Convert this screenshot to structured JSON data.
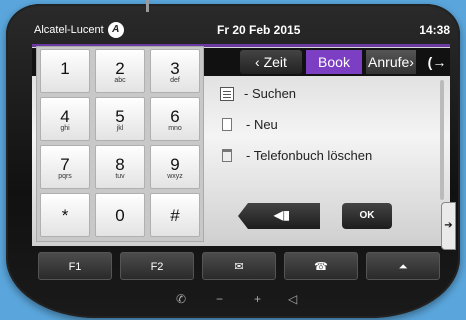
{
  "status": {
    "brand": "Alcatel-Lucent",
    "logo_glyph": "A",
    "date": "Fr 20 Feb 2015",
    "time": "14:38"
  },
  "tabs": {
    "zeit": "‹ Zeit",
    "book": "Book",
    "anrufe": "Anrufe›",
    "exit_icon": "exit-arrow-icon",
    "exit_glyph": "(→"
  },
  "menu": [
    {
      "label": "- Suchen",
      "icon": "list-icon"
    },
    {
      "label": "- Neu",
      "icon": "new-entry-icon"
    },
    {
      "label": "- Telefonbuch löschen",
      "icon": "trash-icon"
    }
  ],
  "keypad": [
    {
      "num": "1",
      "sub": ""
    },
    {
      "num": "2",
      "sub": "abc"
    },
    {
      "num": "3",
      "sub": "def"
    },
    {
      "num": "4",
      "sub": "ghi"
    },
    {
      "num": "5",
      "sub": "jkl"
    },
    {
      "num": "6",
      "sub": "mno"
    },
    {
      "num": "7",
      "sub": "pqrs"
    },
    {
      "num": "8",
      "sub": "tuv"
    },
    {
      "num": "9",
      "sub": "wxyz"
    },
    {
      "num": "*",
      "sub": ""
    },
    {
      "num": "0",
      "sub": ""
    },
    {
      "num": "#",
      "sub": ""
    }
  ],
  "softkeys": {
    "left_glyph": "◀▮",
    "ok": "OK",
    "side_glyph": "➔"
  },
  "function_keys": {
    "f1": "F1",
    "f2": "F2",
    "mail_glyph": "✉",
    "hangup_glyph": "☎",
    "up_glyph": "⏶"
  },
  "bottom_controls": {
    "handset_glyph": "✆",
    "minus": "−",
    "plus": "+",
    "speaker_glyph": "◁"
  },
  "colors": {
    "accent": "#7c3fc4",
    "background": "#5aa6dc"
  }
}
